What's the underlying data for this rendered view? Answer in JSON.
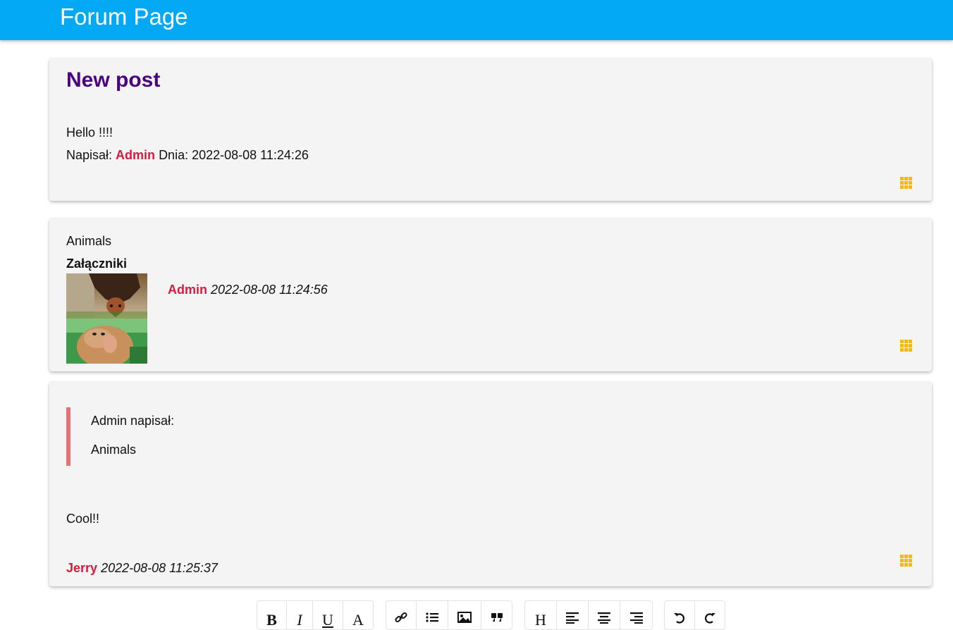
{
  "header": {
    "title": "Forum Page"
  },
  "post": {
    "title": "New post",
    "body": "Hello !!!!",
    "written_by_label": "Napisał:",
    "author": "Admin",
    "date_label": "Dnia:",
    "date": "2022-08-08 11:24:26"
  },
  "reply1": {
    "text": "Animals",
    "attachments_label": "Załączniki",
    "author": "Admin",
    "date": "2022-08-08 11:24:56",
    "attachments": [
      "bat-photo",
      "proboscis-monkey-photo"
    ]
  },
  "reply2": {
    "quote_header": "Admin napisał:",
    "quote_text": "Animals",
    "text": "Cool!!",
    "author": "Jerry",
    "date": "2022-08-08 11:25:37"
  },
  "editor_toolbar": {
    "bold": "B",
    "italic": "I",
    "underline": "U",
    "font": "A",
    "heading": "H",
    "icons": [
      "link-icon",
      "list-icon",
      "image-icon",
      "quote-icon",
      "align-left-icon",
      "align-center-icon",
      "align-right-icon",
      "undo-icon",
      "redo-icon"
    ]
  },
  "colors": {
    "header_bg": "#03a9f4",
    "title_color": "#4b0082",
    "author_color": "#d81b3c",
    "menu_icon_color": "#f5b80f",
    "quote_border": "#e57373",
    "card_bg": "#f4f4f4"
  }
}
